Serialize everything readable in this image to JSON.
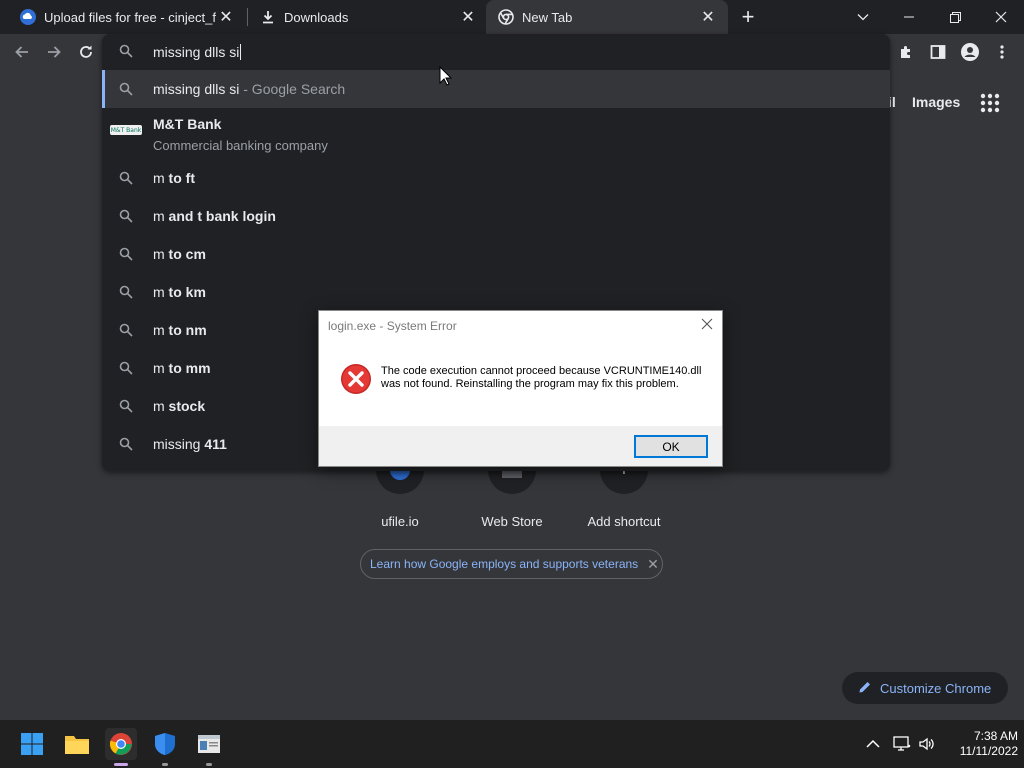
{
  "tabs": [
    {
      "title": "Upload files for free - cinject_fina",
      "icon": "ufile-cloud-icon",
      "active": false
    },
    {
      "title": "Downloads",
      "icon": "download-icon",
      "active": false
    },
    {
      "title": "New Tab",
      "icon": "chrome-icon",
      "active": true
    }
  ],
  "omnibox": {
    "query": "missing dlls si",
    "selected_suggestion": {
      "query": "missing dlls si",
      "suffix": " - Google Search"
    },
    "entity": {
      "title": "M&T Bank",
      "subtitle": "Commercial banking company",
      "logo_text": "M&T Bank"
    },
    "suggestions": [
      {
        "prefix": "m",
        "completion": " to ft"
      },
      {
        "prefix": "m",
        "completion": " and t bank login"
      },
      {
        "prefix": "m",
        "completion": " to cm"
      },
      {
        "prefix": "m",
        "completion": " to km"
      },
      {
        "prefix": "m",
        "completion": " to nm"
      },
      {
        "prefix": "m",
        "completion": " to mm"
      },
      {
        "prefix": "m",
        "completion": " stock"
      },
      {
        "prefix": "missing",
        "completion": " 411"
      }
    ]
  },
  "ntp": {
    "header_link_partial": "il",
    "images_link": "Images",
    "shortcuts": [
      {
        "label": "ufile.io"
      },
      {
        "label": "Web Store"
      },
      {
        "label": "Add shortcut"
      }
    ],
    "promo_text": "Learn how Google employs and supports veterans",
    "customize_label": "Customize Chrome"
  },
  "dialog": {
    "title": "login.exe - System Error",
    "message": "The code execution cannot proceed because VCRUNTIME140.dll was not found. Reinstalling the program may fix this problem.",
    "ok_label": "OK"
  },
  "taskbar": {
    "time": "7:38 AM",
    "date": "11/11/2022"
  },
  "colors": {
    "accent_blue": "#8ab4f8",
    "error_red": "#d32f2f",
    "ok_border": "#0078d7"
  }
}
